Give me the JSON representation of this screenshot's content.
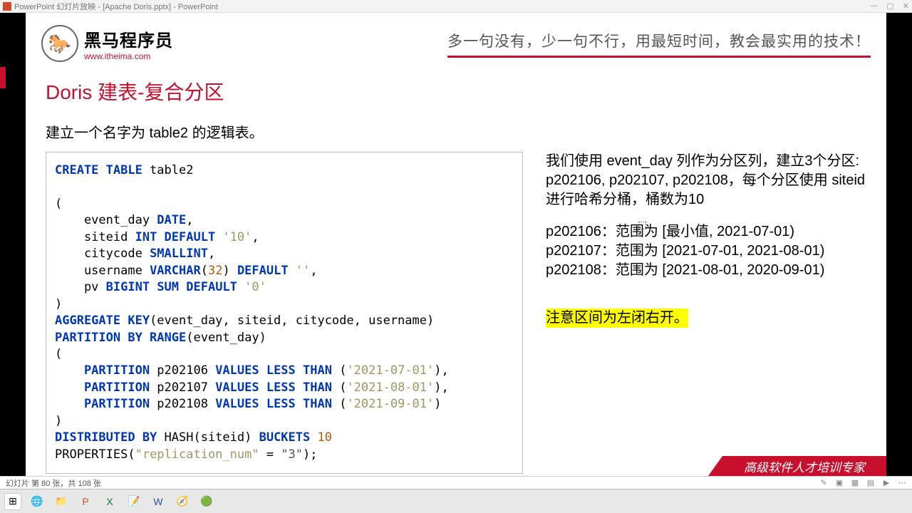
{
  "window": {
    "title": "PowerPoint 幻灯片放映 - [Apache Doris.pptx] - PowerPoint"
  },
  "logo": {
    "name": "黑马程序员",
    "url": "www.itheima.com"
  },
  "tagline": "多一句没有，少一句不行，用最短时间，教会最实用的技术！",
  "h1": "Doris 建表-复合分区",
  "subtitle": "建立一个名字为 table2 的逻辑表。",
  "code": {
    "line1a": "CREATE TABLE",
    "line1b": " table2",
    "open": "(",
    "c1a": "    event_day ",
    "c1b": "DATE",
    "c1c": ",",
    "c2a": "    siteid ",
    "c2b": "INT DEFAULT ",
    "c2c": "'10'",
    "c2d": ",",
    "c3a": "    citycode ",
    "c3b": "SMALLINT",
    "c3c": ",",
    "c4a": "    username ",
    "c4b": "VARCHAR",
    "c4c": "(",
    "c4d": "32",
    "c4e": ") ",
    "c4f": "DEFAULT ",
    "c4g": "''",
    "c4h": ",",
    "c5a": "    pv ",
    "c5b": "BIGINT ",
    "c5c": "SUM DEFAULT ",
    "c5d": "'0'",
    "close": ")",
    "ak": "AGGREGATE KEY",
    "ak2": "(event_day, siteid, citycode, username)",
    "pb": "PARTITION BY RANGE",
    "pb2": "(event_day)",
    "p1a": "    PARTITION",
    "p1b": " p202106 ",
    "p1c": "VALUES LESS THAN ",
    "p1d": "(",
    "p1e": "'2021-07-01'",
    "p1f": "),",
    "p2a": "    PARTITION",
    "p2b": " p202107 ",
    "p2c": "VALUES LESS THAN ",
    "p2d": "(",
    "p2e": "'2021-08-01'",
    "p2f": "),",
    "p3a": "    PARTITION",
    "p3b": " p202108 ",
    "p3c": "VALUES LESS THAN ",
    "p3d": "(",
    "p3e": "'2021-09-01'",
    "p3f": ")",
    "db": "DISTRIBUTED BY",
    "db2": " HASH(siteid) ",
    "db3": "BUCKETS ",
    "db4": "10",
    "pr1": "PROPERTIES(",
    "pr2": "\"replication_num\"",
    "pr3": " = ",
    "pr4": "\"3\"",
    "pr5": ");"
  },
  "right": {
    "p1": "我们使用 event_day 列作为分区列，建立3个分区: p202106, p202107, p202108，每个分区使用 siteid 进行哈希分桶，桶数为10",
    "s1": "p202106：范围为 [最小值, 2021-07-01)",
    "s2": "p202107：范围为 [2021-07-01, 2021-08-01)",
    "s3": "p202108：范围为 [2021-08-01, 2020-09-01)",
    "hl": "注意区间为左闭右开。"
  },
  "footer_band": "高级软件人才培训专家",
  "status": "幻灯片 第 80 张，共 108 张"
}
